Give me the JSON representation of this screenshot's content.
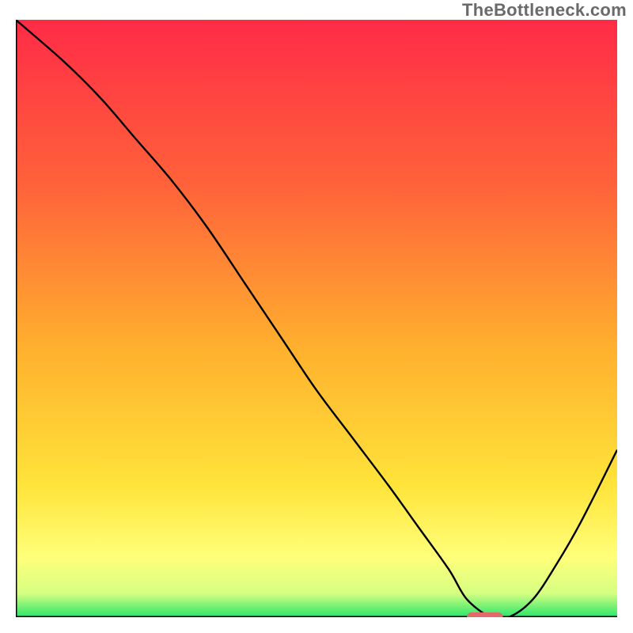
{
  "watermark": "TheBottleneck.com",
  "chart_data": {
    "type": "line",
    "title": "",
    "xlabel": "",
    "ylabel": "",
    "xlim": [
      0,
      100
    ],
    "ylim": [
      0,
      100
    ],
    "grid": false,
    "legend": false,
    "background_gradient_stops": [
      {
        "offset": 0.0,
        "color": "#ff2b47"
      },
      {
        "offset": 0.28,
        "color": "#ff633a"
      },
      {
        "offset": 0.55,
        "color": "#ffb02e"
      },
      {
        "offset": 0.78,
        "color": "#ffe43a"
      },
      {
        "offset": 0.9,
        "color": "#ffff7a"
      },
      {
        "offset": 0.96,
        "color": "#d6ff82"
      },
      {
        "offset": 1.0,
        "color": "#29e66a"
      }
    ],
    "series": [
      {
        "name": "bottleneck-curve",
        "x": [
          0,
          8,
          14,
          20,
          26,
          32,
          38,
          44,
          50,
          56,
          62,
          67,
          72,
          75,
          79,
          82,
          86,
          90,
          94,
          100
        ],
        "y": [
          100,
          93,
          87,
          80,
          73,
          65,
          56,
          47,
          38,
          30,
          22,
          15,
          8,
          3,
          0,
          0,
          3,
          9,
          16,
          28
        ]
      }
    ],
    "marker": {
      "name": "optimal-range",
      "x_center": 78,
      "y": 0,
      "width": 6,
      "color": "#e26a6a"
    },
    "axes_color": "#000000",
    "line_color": "#000000",
    "line_width": 2.4
  }
}
